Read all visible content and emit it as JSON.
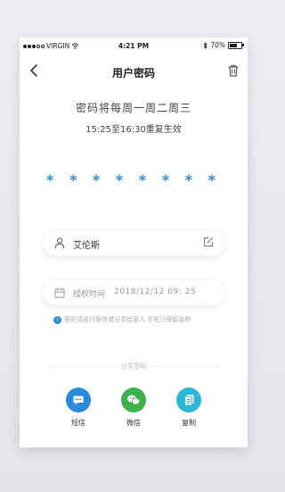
{
  "status_bar": {
    "carrier": "VIRGIN",
    "time": "4:21 PM",
    "battery": "70%",
    "battery_level": 0.7
  },
  "nav": {
    "title": "用户密码",
    "back_icon": "chevron-left-icon",
    "trash_icon": "trash-icon"
  },
  "message": {
    "line1": "密码将每周一周二周三",
    "line2": "15:25至16:30重复生效"
  },
  "password": {
    "masked": "* * * * * * * *"
  },
  "user": {
    "name": "艾伦斯",
    "icon": "person-icon",
    "edit_icon": "edit-icon"
  },
  "auth_time": {
    "label": "授权时间",
    "value": "2018/12/12 09: 25",
    "icon": "calendar-icon"
  },
  "notice": {
    "text": "密码请自行保存或分享给家人,手机只保留名称"
  },
  "share": {
    "label": "分享密码",
    "items": [
      {
        "label": "短信",
        "icon": "sms-icon",
        "color": "#2a8ddb"
      },
      {
        "label": "微信",
        "icon": "wechat-icon",
        "color": "#3cb34a"
      },
      {
        "label": "复制",
        "icon": "copy-icon",
        "color": "#29b8d6"
      }
    ]
  },
  "colors": {
    "accent": "#2a8ddb"
  }
}
